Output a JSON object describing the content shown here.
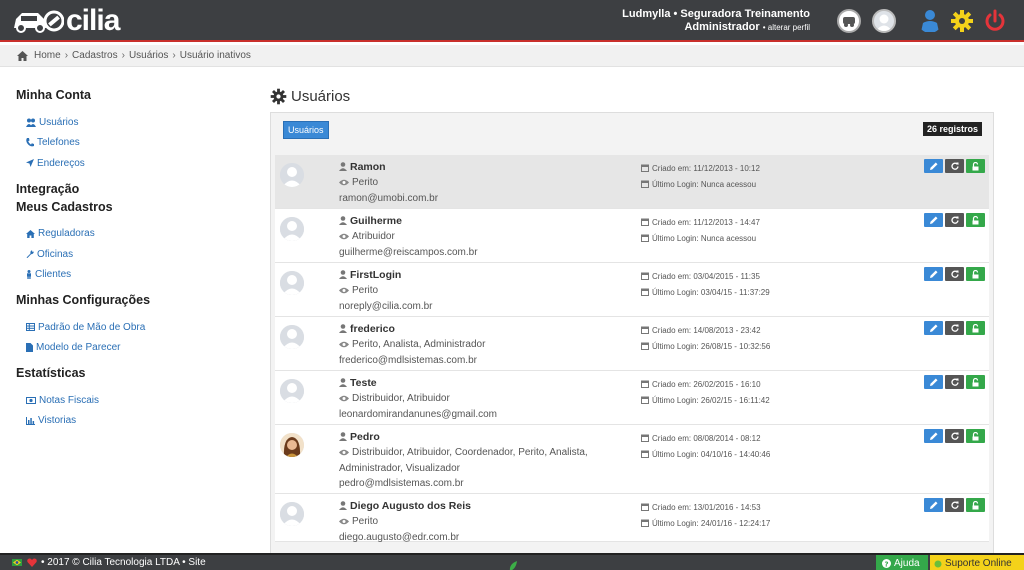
{
  "header": {
    "logo_text": "cilia",
    "user_line": "Ludmylla • Seguradora Treinamento",
    "role": "Administrador",
    "change_profile": "• alterar perfil"
  },
  "breadcrumb": [
    "Home",
    "Cadastros",
    "Usuários",
    "Usuário inativos"
  ],
  "sidebar": {
    "sections": [
      {
        "title": "Minha Conta",
        "items": [
          {
            "label": "Usuários",
            "icon": "users-icon"
          },
          {
            "label": "Telefones",
            "icon": "phone-icon"
          },
          {
            "label": "Endereços",
            "icon": "location-arrow-icon"
          }
        ]
      },
      {
        "title": "Integração",
        "items": []
      },
      {
        "title": "Meus Cadastros",
        "items": [
          {
            "label": "Reguladoras",
            "icon": "home-icon"
          },
          {
            "label": "Oficinas",
            "icon": "wrench-icon"
          },
          {
            "label": "Clientes",
            "icon": "person-icon"
          }
        ]
      },
      {
        "title": "Minhas Configurações",
        "items": [
          {
            "label": "Padrão de Mão de Obra",
            "icon": "table-icon"
          },
          {
            "label": "Modelo de Parecer",
            "icon": "file-icon"
          }
        ]
      },
      {
        "title": "Estatísticas",
        "items": [
          {
            "label": "Notas Fiscais",
            "icon": "money-icon"
          },
          {
            "label": "Vistorias",
            "icon": "bar-chart-icon"
          }
        ]
      }
    ]
  },
  "main": {
    "title": "Usuários",
    "tag": "Usuários",
    "count": "26 registros",
    "users": [
      {
        "name": "Ramon",
        "roles": "Perito",
        "email": "ramon@umobi.com.br",
        "created": "Criado em: 11/12/2013 - 10:12",
        "last_login": "Último Login: Nunca acessou",
        "photo": false,
        "highlight": true
      },
      {
        "name": "Guilherme",
        "roles": "Atribuidor",
        "email": "guilherme@reiscampos.com.br",
        "created": "Criado em: 11/12/2013 - 14:47",
        "last_login": "Último Login: Nunca acessou",
        "photo": false
      },
      {
        "name": "FirstLogin",
        "roles": "Perito",
        "email": "noreply@cilia.com.br",
        "created": "Criado em: 03/04/2015 - 11:35",
        "last_login": "Último Login: 03/04/15 - 11:37:29",
        "photo": false
      },
      {
        "name": "frederico",
        "roles": "Perito, Analista, Administrador",
        "email": "frederico@mdlsistemas.com.br",
        "created": "Criado em: 14/08/2013 - 23:42",
        "last_login": "Último Login: 26/08/15 - 10:32:56",
        "photo": false
      },
      {
        "name": "Teste",
        "roles": "Distribuidor, Atribuidor",
        "email": "leonardomirandanunes@gmail.com",
        "created": "Criado em: 26/02/2015 - 16:10",
        "last_login": "Último Login: 26/02/15 - 16:11:42",
        "photo": false
      },
      {
        "name": "Pedro",
        "roles": "Distribuidor, Atribuidor, Coordenador, Perito, Analista, Administrador, Visualizador",
        "email": "pedro@mdlsistemas.com.br",
        "created": "Criado em: 08/08/2014 - 08:12",
        "last_login": "Último Login: 04/10/16 - 14:40:46",
        "photo": true
      },
      {
        "name": "Diego Augusto dos Reis",
        "roles": "Perito",
        "email": "diego.augusto@edr.com.br",
        "created": "Criado em: 13/01/2016 - 14:53",
        "last_login": "Último Login: 24/01/16 - 12:24:17",
        "photo": false
      }
    ]
  },
  "footer": {
    "text": "• 2017 © Cilia Tecnologia LTDA • Site",
    "help": "Ajuda",
    "support": "Suporte Online"
  },
  "colors": {
    "accent_blue": "#3a89d6",
    "success_green": "#34a84a",
    "topbar": "#3d3f42",
    "gear_yellow": "#f4d21a",
    "power_red": "#e5343a"
  }
}
